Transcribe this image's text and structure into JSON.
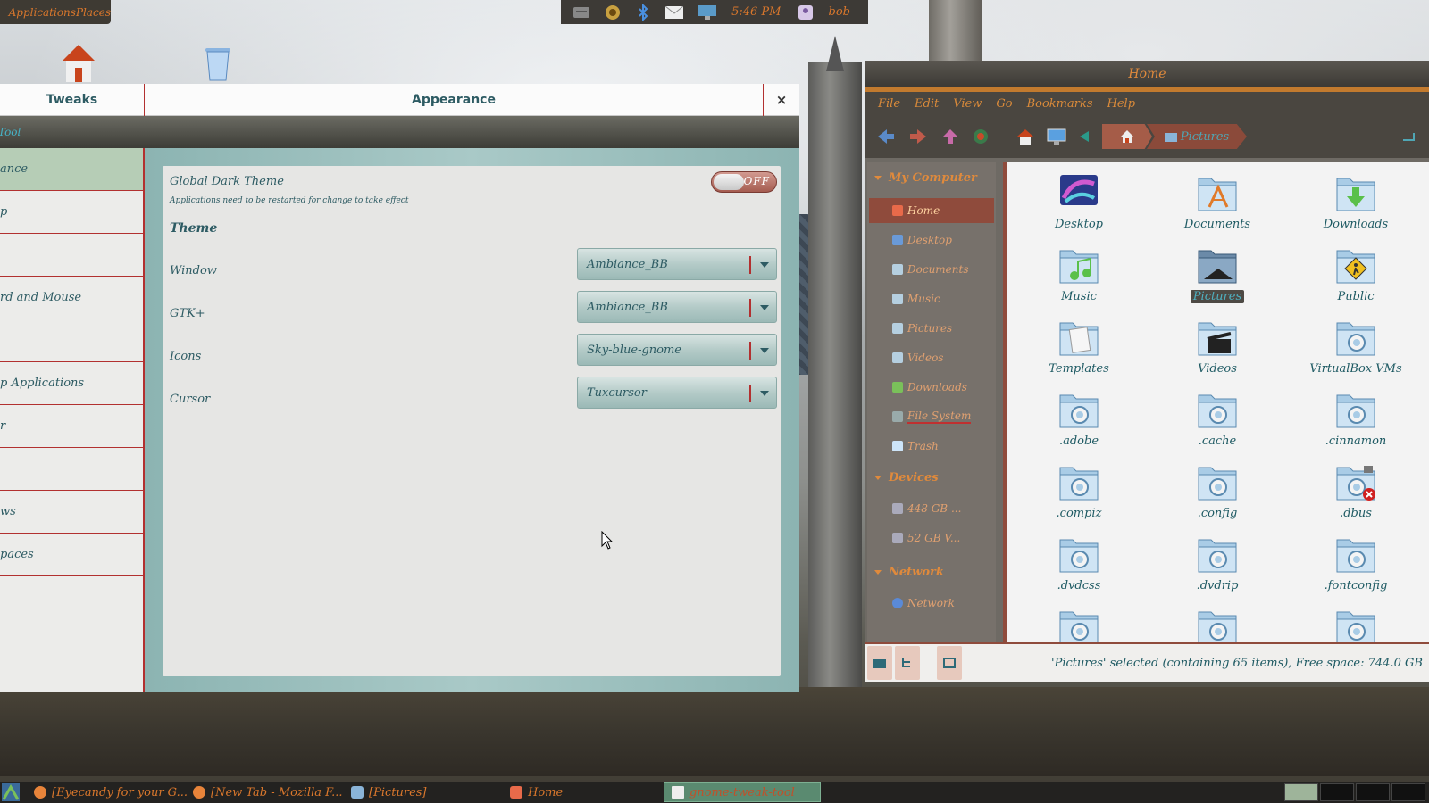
{
  "top_panel": {
    "app_menu_label": "ApplicationsPlaces",
    "tray": {
      "icons": [
        "keyboard-icon",
        "sound-icon",
        "bluetooth-icon",
        "mail-icon",
        "network-icon",
        "user-icon"
      ],
      "time": "5:46 PM",
      "user": "bob"
    }
  },
  "desktop": {
    "icons": [
      "home-icon",
      "trash-icon"
    ]
  },
  "tweaks": {
    "app_tab": "Tweaks",
    "title": "Appearance",
    "close_label": "×",
    "toolbar_label": "Tool",
    "sidebar": [
      {
        "label": "ance",
        "active": true
      },
      {
        "label": "p",
        "active": false
      },
      {
        "label": "",
        "active": false
      },
      {
        "label": "rd and Mouse",
        "active": false
      },
      {
        "label": "",
        "active": false
      },
      {
        "label": "p Applications",
        "active": false
      },
      {
        "label": "r",
        "active": false
      },
      {
        "label": "",
        "active": false
      },
      {
        "label": "ws",
        "active": false
      },
      {
        "label": "paces",
        "active": false
      }
    ],
    "global_dark": {
      "label": "Global Dark Theme",
      "note": "Applications need to be restarted for change to take effect",
      "switch_state": "OFF"
    },
    "theme_heading": "Theme",
    "rows": [
      {
        "label": "Window",
        "value": "Ambiance_BB"
      },
      {
        "label": "GTK+",
        "value": "Ambiance_BB"
      },
      {
        "label": "Icons",
        "value": "Sky-blue-gnome"
      },
      {
        "label": "Cursor",
        "value": "Tuxcursor"
      }
    ]
  },
  "nemo": {
    "title": "Home",
    "menu": [
      "File",
      "Edit",
      "View",
      "Go",
      "Bookmarks",
      "Help"
    ],
    "breadcrumb": {
      "current": "Pictures"
    },
    "sidebar": {
      "sections": [
        {
          "name": "My Computer",
          "items": [
            {
              "label": "Home",
              "active": true
            },
            {
              "label": "Desktop",
              "active": false
            },
            {
              "label": "Documents",
              "active": false
            },
            {
              "label": "Music",
              "active": false
            },
            {
              "label": "Pictures",
              "active": false
            },
            {
              "label": "Videos",
              "active": false
            },
            {
              "label": "Downloads",
              "active": false
            },
            {
              "label": "File System",
              "active": false
            },
            {
              "label": "Trash",
              "active": false
            }
          ]
        },
        {
          "name": "Devices",
          "items": [
            {
              "label": "448 GB ...",
              "active": false
            },
            {
              "label": "52 GB V...",
              "active": false
            }
          ]
        },
        {
          "name": "Network",
          "items": [
            {
              "label": "Network",
              "active": false
            }
          ]
        }
      ]
    },
    "files": [
      {
        "name": "Desktop",
        "kind": "desktop"
      },
      {
        "name": "Documents",
        "kind": "documents"
      },
      {
        "name": "Downloads",
        "kind": "downloads"
      },
      {
        "name": "Music",
        "kind": "music"
      },
      {
        "name": "Pictures",
        "kind": "pictures",
        "selected": true
      },
      {
        "name": "Public",
        "kind": "public"
      },
      {
        "name": "Templates",
        "kind": "templates"
      },
      {
        "name": "Videos",
        "kind": "videos"
      },
      {
        "name": "VirtualBox VMs",
        "kind": "gear"
      },
      {
        "name": ".adobe",
        "kind": "gear"
      },
      {
        "name": ".cache",
        "kind": "gear"
      },
      {
        "name": ".cinnamon",
        "kind": "gear"
      },
      {
        "name": ".compiz",
        "kind": "gear"
      },
      {
        "name": ".config",
        "kind": "gear"
      },
      {
        "name": ".dbus",
        "kind": "locked"
      },
      {
        "name": ".dvdcss",
        "kind": "gear"
      },
      {
        "name": ".dvdrip",
        "kind": "gear"
      },
      {
        "name": ".fontconfig",
        "kind": "gear"
      },
      {
        "name": "",
        "kind": "gear"
      },
      {
        "name": "",
        "kind": "gear"
      },
      {
        "name": "",
        "kind": "gear"
      }
    ],
    "status": "'Pictures' selected (containing 65 items), Free space: 744.0 GB"
  },
  "taskbar": {
    "tasks": [
      {
        "label": "[Eyecandy for your G...",
        "icon": "firefox-icon",
        "active": false
      },
      {
        "label": "[New Tab - Mozilla F...",
        "icon": "firefox-icon",
        "active": false
      },
      {
        "label": "[Pictures]",
        "icon": "folder-icon",
        "active": false
      },
      {
        "label": "Home",
        "icon": "home-icon",
        "active": false
      },
      {
        "label": "gnome-tweak-tool",
        "icon": "window-icon",
        "active": true
      }
    ],
    "workspaces": 4,
    "active_workspace": 1
  },
  "colors": {
    "accent_orange": "#d9772c",
    "teal_text": "#2d5b63",
    "red_divider": "#b23030"
  }
}
